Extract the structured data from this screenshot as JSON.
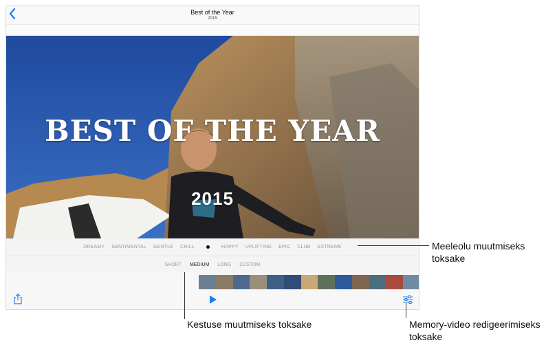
{
  "nav": {
    "title": "Best of the Year",
    "subtitle": "2015"
  },
  "hero": {
    "title": "BEST OF THE YEAR",
    "year": "2015"
  },
  "moods": {
    "left": [
      "DREAMY",
      "SENTIMENTAL",
      "GENTLE",
      "CHILL"
    ],
    "right": [
      "HAPPY",
      "UPLIFTING",
      "EPIC",
      "CLUB",
      "EXTREME"
    ]
  },
  "lengths": [
    "SHORT",
    "MEDIUM",
    "LONG",
    "CUSTOM"
  ],
  "selected_length": "MEDIUM",
  "callouts": {
    "mood": "Meeleolu muutmiseks toksake",
    "duration": "Kestuse muutmiseks toksake",
    "edit": "Memory-video redigeerimiseks toksake"
  },
  "colors": {
    "accent": "#1a7cf5"
  },
  "icons": {
    "back": "chevron-left-icon",
    "share": "share-icon",
    "play": "play-icon",
    "edit": "sliders-icon"
  }
}
